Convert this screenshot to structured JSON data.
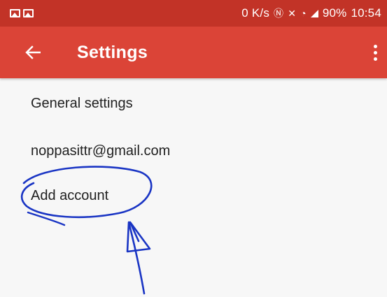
{
  "status_bar": {
    "network_speed": "0 K/s",
    "battery": "90%",
    "time": "10:54",
    "icons": [
      "image-icon",
      "image-icon",
      "nfc-icon",
      "vibrate-icon",
      "wifi-icon",
      "signal-icon"
    ]
  },
  "app_bar": {
    "title": "Settings",
    "back_icon": "arrow-left-icon",
    "menu_icon": "more-vertical-icon"
  },
  "settings": {
    "items": [
      {
        "label": "General settings"
      },
      {
        "label": "noppasittr@gmail.com"
      },
      {
        "label": "Add account"
      }
    ]
  },
  "colors": {
    "status_bar": "#c23327",
    "app_bar": "#db4437",
    "background": "#f7f7f7",
    "annotation": "#1a35c4"
  }
}
